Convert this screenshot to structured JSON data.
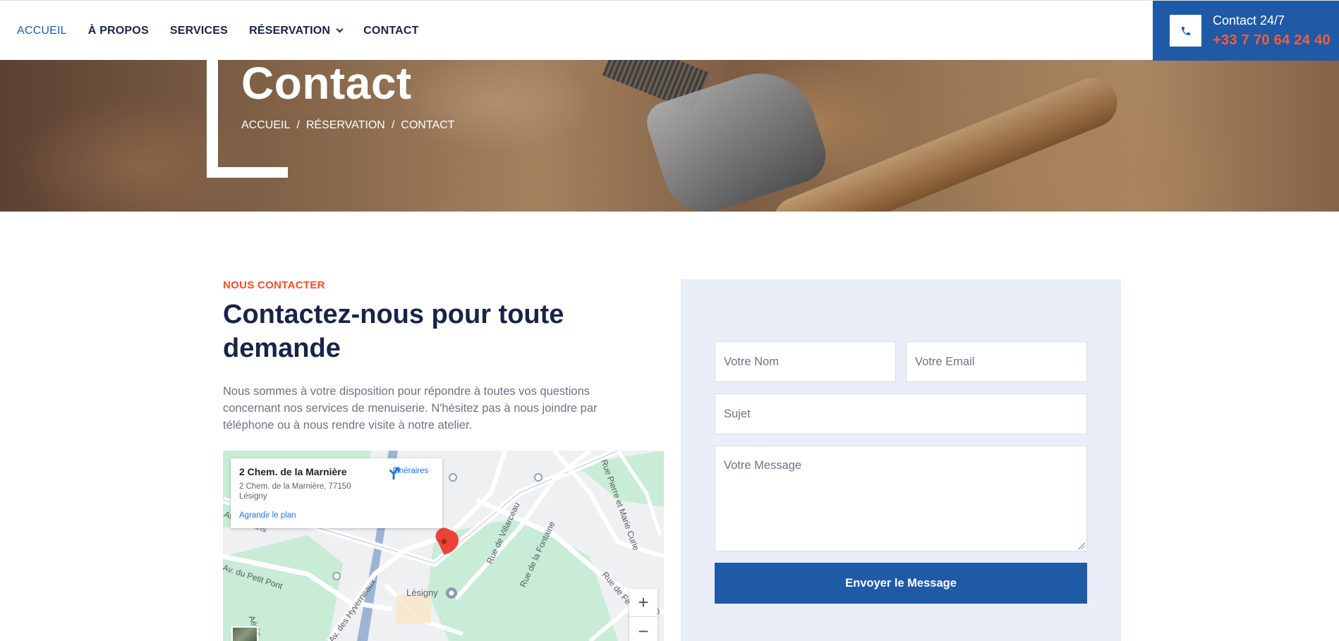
{
  "nav": {
    "items": [
      {
        "label": "ACCUEIL",
        "active": true
      },
      {
        "label": "À PROPOS"
      },
      {
        "label": "SERVICES"
      },
      {
        "label": "RÉSERVATION",
        "has_dropdown": true
      },
      {
        "label": "CONTACT"
      }
    ],
    "contact_label": "Contact 24/7",
    "contact_phone": "+33 7 70 64 24 40",
    "icon": "phone-icon"
  },
  "hero": {
    "title": "Contact",
    "breadcrumb": [
      "ACCUEIL",
      "/",
      "RÉSERVATION",
      "/",
      "CONTACT"
    ]
  },
  "section": {
    "eyebrow": "NOUS CONTACTER",
    "heading": "Contactez-nous pour toute demande",
    "intro": "Nous sommes à votre disposition pour répondre à toutes vos questions concernant nos services de menuiserie. N'hésitez pas à nous joindre par téléphone ou à nous rendre visite à notre atelier."
  },
  "map": {
    "place_title": "2 Chem. de la Marnière",
    "place_address": "2 Chem. de la Marnière, 77150 Lésigny",
    "enlarge_link": "Agrandir le plan",
    "directions_label": "Itinéraires",
    "town": "Lésigny",
    "streets": [
      "Rue de Villarceau",
      "Rue de la Fontaine",
      "Rue Pierre et Marie Curie",
      "Rue de Fé",
      "Av. de Paris",
      "Av. du Petit Pont",
      "Av. des Hyverneaux",
      "Aérés"
    ],
    "zoom_in": "+",
    "zoom_out": "−",
    "colors": {
      "water": "#9db4d6",
      "park": "#c8ecd6",
      "land": "#eef0f2",
      "pin": "#ea4335"
    }
  },
  "form": {
    "name_placeholder": "Votre Nom",
    "email_placeholder": "Votre Email",
    "subject_placeholder": "Sujet",
    "message_placeholder": "Votre Message",
    "submit_label": "Envoyer le Message"
  },
  "colors": {
    "primary": "#1f5aa6",
    "accent": "#ff4c1f",
    "navy": "#182447",
    "panel": "#e9eef8"
  }
}
